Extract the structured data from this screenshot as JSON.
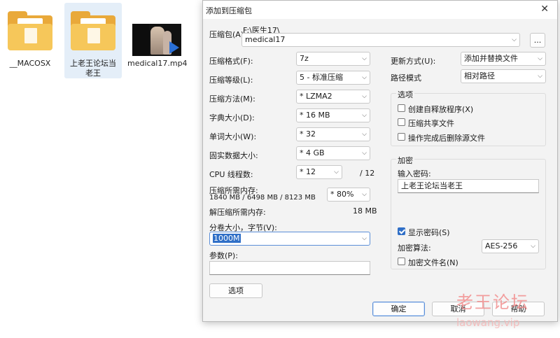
{
  "desktop": {
    "files": [
      {
        "name": "__MACOSX",
        "type": "folder"
      },
      {
        "name": "上老王论坛当老王",
        "type": "folder"
      },
      {
        "name": "medical17.mp4",
        "type": "video"
      }
    ]
  },
  "dialog": {
    "title": "添加到压缩包",
    "close_glyph": "✕",
    "archive": {
      "label": "压缩包(A)",
      "path": "F:\\医生17\\",
      "value": "medical17",
      "browse_label": "..."
    },
    "left": {
      "format": {
        "label": "压缩格式(F):",
        "value": "7z"
      },
      "level": {
        "label": "压缩等级(L):",
        "value": "5 - 标准压缩"
      },
      "method": {
        "label": "压缩方法(M):",
        "value": "* LZMA2"
      },
      "dict": {
        "label": "字典大小(D):",
        "value": "* 16 MB"
      },
      "word": {
        "label": "单词大小(W):",
        "value": "* 32"
      },
      "solid": {
        "label": "固实数据大小:",
        "value": "* 4 GB"
      },
      "threads": {
        "label": "CPU 线程数:",
        "value": "* 12",
        "max": "/ 12"
      },
      "mem_compress": {
        "label": "压缩所需内存:",
        "detail": "1840 MB / 6498 MB / 8123 MB",
        "percent": "* 80%"
      },
      "mem_decompress": {
        "label": "解压缩所需内存:",
        "value": "18 MB"
      },
      "split": {
        "label": "分卷大小，字节(V):",
        "value": "1000M"
      },
      "params": {
        "label": "参数(P):",
        "value": ""
      },
      "options_button": "选项"
    },
    "right": {
      "update": {
        "label": "更新方式(U):",
        "value": "添加并替换文件"
      },
      "pathmode": {
        "label": "路径模式",
        "value": "相对路径"
      },
      "options_group": {
        "label": "选项",
        "items": [
          {
            "label": "创建自释放程序(X)",
            "checked": false
          },
          {
            "label": "压缩共享文件",
            "checked": false
          },
          {
            "label": "操作完成后删除源文件",
            "checked": false
          }
        ]
      },
      "encrypt_group": {
        "label": "加密",
        "password_label": "输入密码:",
        "password_value": "上老王论坛当老王",
        "show_password": {
          "label": "显示密码(S)",
          "checked": true
        },
        "algo": {
          "label": "加密算法:",
          "value": "AES-256"
        },
        "encrypt_names": {
          "label": "加密文件名(N)",
          "checked": false
        }
      }
    },
    "buttons": {
      "ok": "确定",
      "cancel": "取消",
      "help": "帮助"
    }
  },
  "watermark": {
    "line1": "老王论坛",
    "line2": "laowang.vip"
  }
}
